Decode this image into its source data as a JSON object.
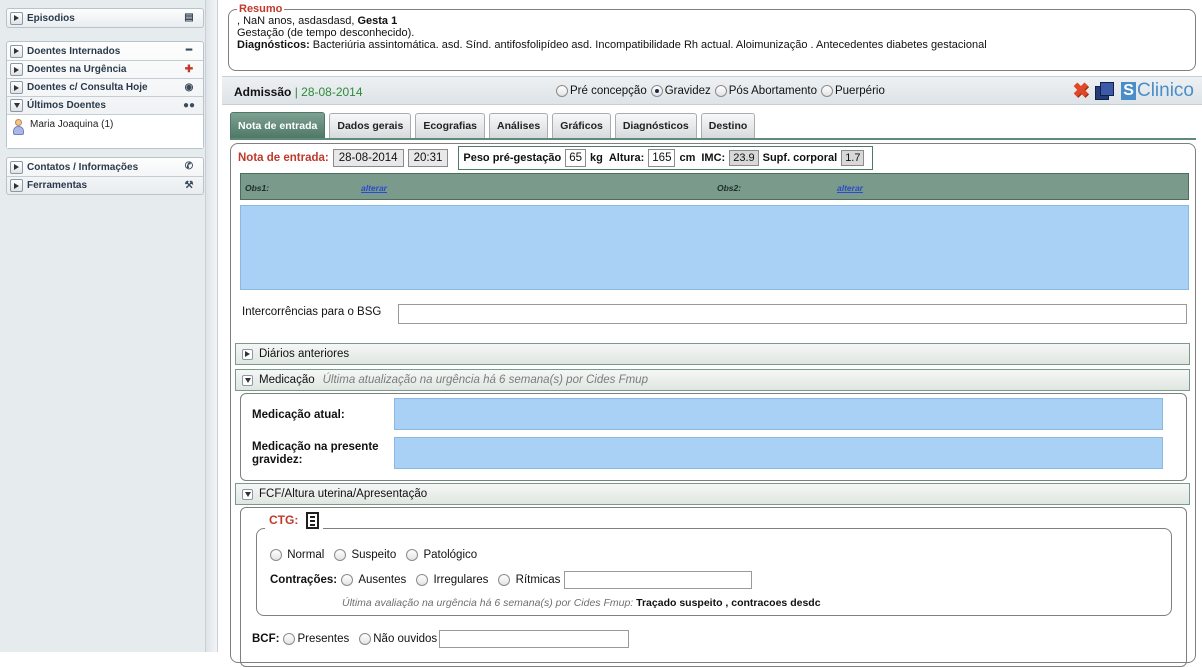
{
  "sidebar": {
    "episodios": "Episodios",
    "doentes_internados": "Doentes Internados",
    "doentes_urgencia": "Doentes na Urgência",
    "doentes_consulta": "Doentes c/ Consulta Hoje",
    "ultimos_doentes": "Últimos Doentes",
    "patient": "Maria Joaquina  (1)",
    "contatos": "Contatos / Informações",
    "ferramentas": "Ferramentas"
  },
  "resumo": {
    "legend": "Resumo",
    "line1_pre": ", NaN anos, asdasdasd, ",
    "line1_bold": "Gesta 1",
    "line2": "Gestação (de tempo desconhecido).",
    "line3_label": "Diagnósticos:",
    "line3_text": " Bacteriúria assintomática. asd. Sínd. antifosfolipídeo asd. Incompatibilidade Rh actual. Aloimunização . Antecedentes diabetes gestacional"
  },
  "admissao": {
    "title": "Admissão",
    "date": " | 28-08-2014",
    "phases": [
      "Pré concepção",
      "Gravidez",
      "Pós Abortamento",
      "Puerpério"
    ],
    "selected_phase": "Gravidez",
    "logo_text": "Clinico"
  },
  "tabs": [
    "Nota de entrada",
    "Dados gerais",
    "Ecografias",
    "Análises",
    "Gráficos",
    "Diagnósticos",
    "Destino"
  ],
  "nota": {
    "label": "Nota de entrada:",
    "date": "28-08-2014",
    "time": "20:31",
    "peso_label": "Peso pré-gestação",
    "peso_value": "65",
    "peso_unit": "kg",
    "altura_label": "Altura:",
    "altura_value": "165",
    "altura_unit": "cm",
    "imc_label": "IMC:",
    "imc_value": "23.9",
    "supf_label": "Supf. corporal",
    "supf_value": "1.7"
  },
  "obs": {
    "obs1": "Obs1:",
    "obs1_link": "alterar",
    "obs2": "Obs2:",
    "obs2_link": "alterar"
  },
  "intercorrencias_label": "Intercorrências para o BSG",
  "diarios": "Diários anteriores",
  "medicacao": {
    "title": "Medicação",
    "note": "Última atualização na urgência há 6 semana(s) por Cides Fmup",
    "atual_label": "Medicação atual:",
    "gravidez_label": "Medicação na presente gravidez:"
  },
  "fcf": {
    "title": "FCF/Altura uterina/Apresentação",
    "ctg_label": "CTG:",
    "ctg_options": [
      "Normal",
      "Suspeito",
      "Patológico"
    ],
    "contracoes_label": "Contrações:",
    "contracoes_options": [
      "Ausentes",
      "Irregulares",
      "Rítmicas"
    ],
    "ctg_note_pre": "Última avaliação na urgência há 6 semana(s) por Cides Fmup: ",
    "ctg_note_bold": "Traçado suspeito , contracoes desdc",
    "bcf_label": "BCF:",
    "bcf_options": [
      "Presentes",
      "Não ouvidos"
    ]
  }
}
